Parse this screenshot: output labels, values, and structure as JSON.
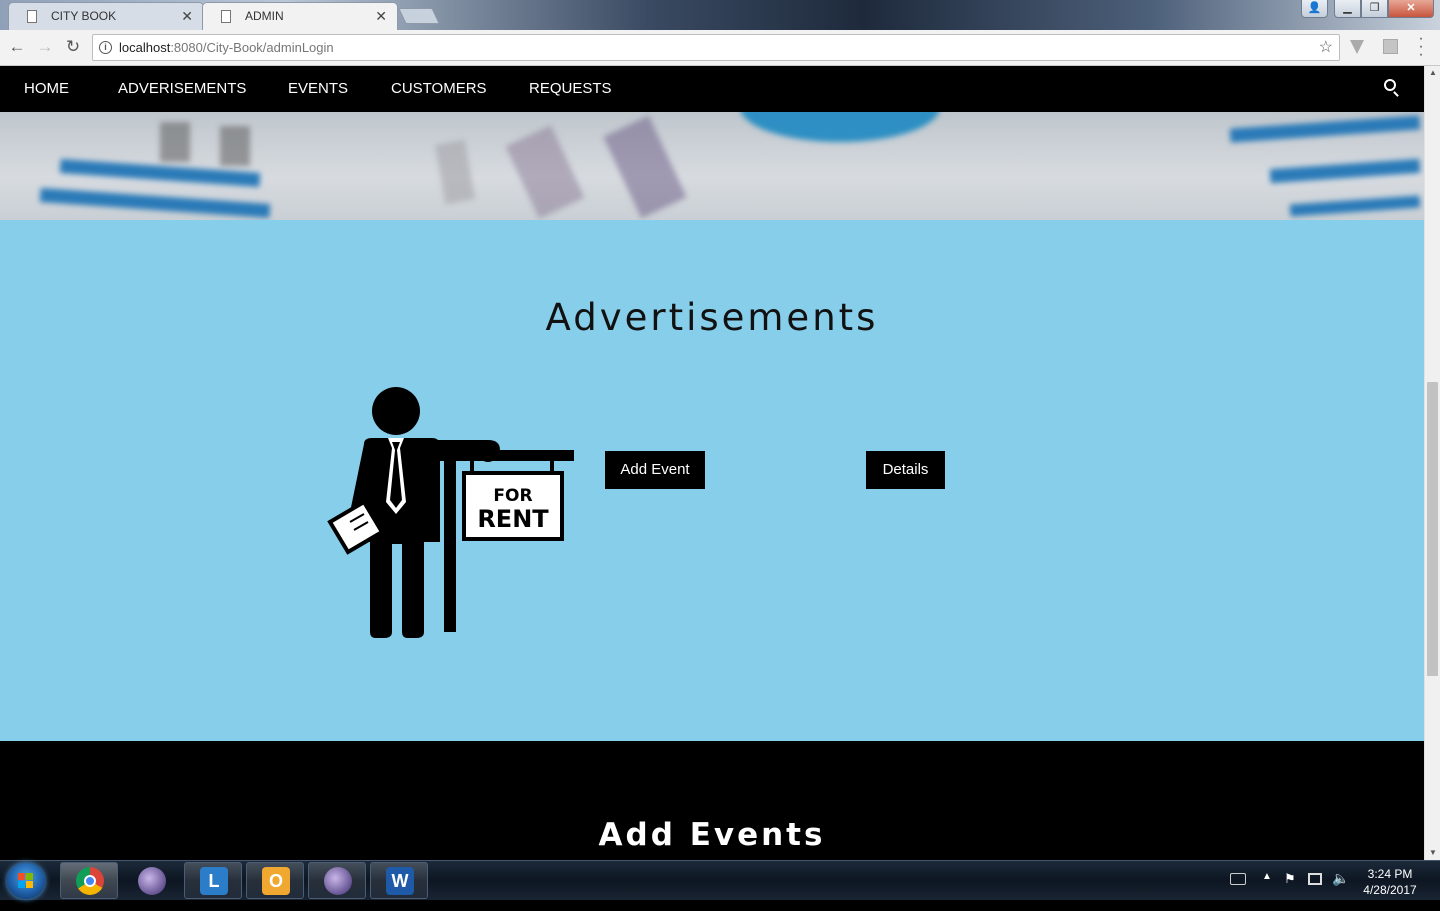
{
  "browser": {
    "tabs": [
      {
        "label": "CITY BOOK",
        "active": false
      },
      {
        "label": "ADMIN",
        "active": true
      }
    ],
    "url_host": "localhost",
    "url_path": ":8080/City-Book/adminLogin"
  },
  "navbar": {
    "items": [
      "HOME",
      "ADVERISEMENTS",
      "EVENTS",
      "CUSTOMERS",
      "REQUESTS"
    ]
  },
  "advertisements": {
    "title": "Advertisements",
    "add_event_label": "Add Event",
    "details_label": "Details",
    "sign_line1": "FOR",
    "sign_line2": "RENT"
  },
  "events_section": {
    "title": "Add Events"
  },
  "taskbar": {
    "time": "3:24 PM",
    "date": "4/28/2017"
  },
  "colors": {
    "section_bg": "#87ceeb",
    "nav_bg": "#000000",
    "button_bg": "#000000"
  }
}
